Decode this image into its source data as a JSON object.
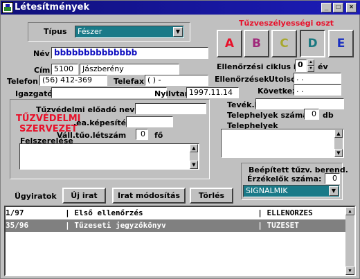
{
  "window": {
    "title": "Létesítmények",
    "buttons": [
      "_",
      "□",
      "×"
    ]
  },
  "tipus": {
    "label": "Típus",
    "value": "Fészer"
  },
  "fire_class": {
    "title": "Tűzveszélyességi oszt",
    "selected": "D",
    "classes": [
      {
        "letter": "A",
        "color": "#e8102a"
      },
      {
        "letter": "B",
        "color": "#a0287a"
      },
      {
        "letter": "C",
        "color": "#a8a830"
      },
      {
        "letter": "D",
        "color": "#1a7880"
      },
      {
        "letter": "E",
        "color": "#1a30c0"
      }
    ]
  },
  "nev": {
    "label": "Név",
    "value": "bbbbbbbbbbbbbb"
  },
  "cim": {
    "label": "Cím",
    "zip": "5100",
    "city": "Jászberény"
  },
  "telefon": {
    "label": "Telefon",
    "value": "(56) 412-369"
  },
  "telefax": {
    "label": "Telefax",
    "value": "(  )    -"
  },
  "igazgato": {
    "label": "Igazgató",
    "value": ""
  },
  "nyilvtart": {
    "label": "Nyilvtart",
    "value": "1997.11.14"
  },
  "ellenorzesi": {
    "label": "Ellenőrzési ciklus idő",
    "value": "0",
    "unit": "év"
  },
  "ellenorzesek": {
    "label": "Ellenőrzések",
    "utolso_label": "Utolsó",
    "utolso_value": " .  .",
    "kovetkezo_label": "Következő",
    "kovetkezo_value": " .  ."
  },
  "tuzvedelmi": {
    "eloado_label": "Tűzvédelmi előadó neve",
    "eloado_value": "",
    "szervezet_line1": "TŰZVÉDELMI",
    "szervezet_line2": "SZERVEZET",
    "kepesitese_label": ".ea.képesítése",
    "kepesitese_value": "",
    "letszam_label": "Váll.tűo.létszám",
    "letszam_value": "0",
    "fo_label": "fő",
    "felszerelese_label": "Felszerelése"
  },
  "tevek": {
    "label": "Tevék.kö",
    "value": ""
  },
  "telephelyek_szama": {
    "label": "Telephelyek száma",
    "value": "0",
    "unit": "db"
  },
  "telephelyek": {
    "label": "Telephelyek"
  },
  "beepitett": {
    "title": "Beépített tűzv. berend.",
    "erzekelok_label": "Érzékelők száma:",
    "erzekelok_value": "0",
    "dropdown_value": "SIGNALMIK"
  },
  "ugyiratok": {
    "label": "Ügyiratok",
    "new_button": "Új irat",
    "modify_button": "Irat módosítás",
    "delete_button": "Törlés",
    "rows": [
      {
        "text": "1/97         | Első ellenőrzés                         | ELLENORZES"
      },
      {
        "text": "35/96        | Tűzeseti jegyzőkönyv                    | TUZESET"
      }
    ],
    "selected_row": 1
  }
}
